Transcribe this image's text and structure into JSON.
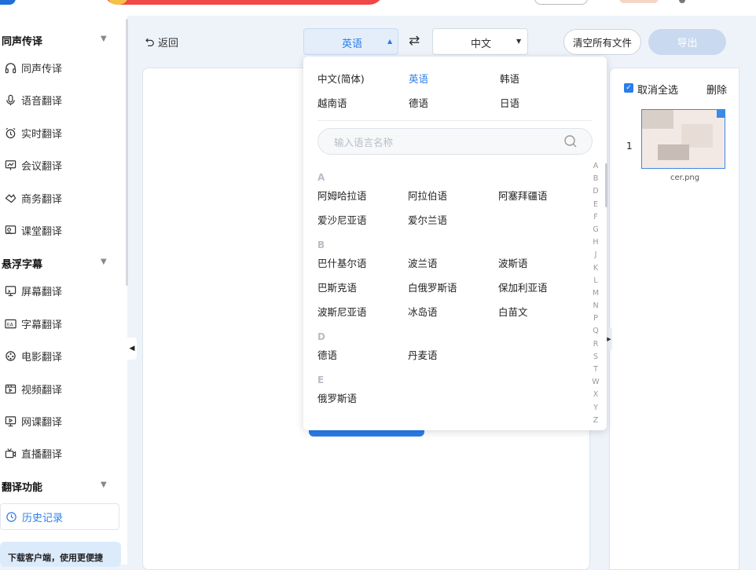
{
  "sidebar": {
    "sections": [
      {
        "label": "同声传译",
        "items": [
          "同声传译",
          "语音翻译",
          "实时翻译",
          "会议翻译",
          "商务翻译",
          "课堂翻译"
        ]
      },
      {
        "label": "悬浮字幕",
        "items": [
          "屏幕翻译",
          "字幕翻译",
          "电影翻译",
          "视频翻译",
          "网课翻译",
          "直播翻译"
        ]
      },
      {
        "label": "翻译功能",
        "items": [
          "历史记录"
        ]
      }
    ],
    "download_banner": "下载客户端，使用更便捷"
  },
  "toolbar": {
    "back_label": "返回",
    "source_language": "英语",
    "swap_icon": "swap-arrows-icon",
    "target_language": "中文",
    "clear_label": "清空所有文件",
    "export_label": "导出"
  },
  "file_panel": {
    "deselect_label": "取消全选",
    "delete_label": "删除",
    "files": [
      {
        "index": "1",
        "name": "cer.png"
      }
    ]
  },
  "language_dropdown": {
    "common": [
      "中文(简体)",
      "英语",
      "韩语",
      "越南语",
      "德语",
      "日语"
    ],
    "active": "英语",
    "search_placeholder": "输入语言名称",
    "groups": [
      {
        "letter": "A",
        "languages": [
          "阿姆哈拉语",
          "阿拉伯语",
          "阿塞拜疆语",
          "爱沙尼亚语",
          "爱尔兰语"
        ]
      },
      {
        "letter": "B",
        "languages": [
          "巴什基尔语",
          "波兰语",
          "波斯语",
          "巴斯克语",
          "白俄罗斯语",
          "保加利亚语",
          "波斯尼亚语",
          "冰岛语",
          "白苗文"
        ]
      },
      {
        "letter": "D",
        "languages": [
          "德语",
          "丹麦语"
        ]
      },
      {
        "letter": "E",
        "languages": [
          "俄罗斯语"
        ]
      }
    ],
    "alphabet": [
      "A",
      "B",
      "D",
      "E",
      "F",
      "G",
      "H",
      "J",
      "K",
      "L",
      "M",
      "N",
      "P",
      "Q",
      "R",
      "S",
      "T",
      "W",
      "X",
      "Y",
      "Z"
    ]
  },
  "colors": {
    "accent": "#2b7de9",
    "background": "#eef3fa"
  }
}
